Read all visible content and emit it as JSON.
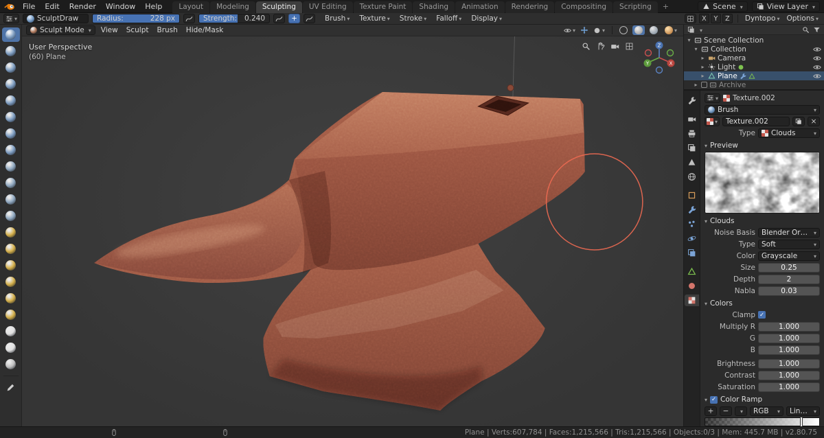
{
  "topbar": {
    "menus": [
      "File",
      "Edit",
      "Render",
      "Window",
      "Help"
    ],
    "tabs": [
      {
        "label": "Layout"
      },
      {
        "label": "Modeling"
      },
      {
        "label": "Sculpting",
        "active": true
      },
      {
        "label": "UV Editing"
      },
      {
        "label": "Texture Paint"
      },
      {
        "label": "Shading"
      },
      {
        "label": "Animation"
      },
      {
        "label": "Rendering"
      },
      {
        "label": "Compositing"
      },
      {
        "label": "Scripting"
      }
    ],
    "add_tab": "+",
    "scene_label": "Scene",
    "view_layer_label": "View Layer"
  },
  "tool_settings": {
    "brush_name": "SculptDraw",
    "radius": {
      "label": "Radius:",
      "value": "228 px",
      "fill": 1
    },
    "strength": {
      "label": "Strength:",
      "value": "0.240",
      "fill": 0.55
    },
    "plus": "+",
    "popovers": [
      {
        "label": "Brush"
      },
      {
        "label": "Texture"
      },
      {
        "label": "Stroke"
      },
      {
        "label": "Falloff"
      },
      {
        "label": "Display"
      }
    ],
    "mirror": [
      {
        "label": "X"
      },
      {
        "label": "Y"
      },
      {
        "label": "Z"
      }
    ],
    "dyntopo_label": "Dyntopo",
    "options_label": "Options"
  },
  "viewport_header": {
    "mode": "Sculpt Mode",
    "menus": [
      {
        "label": "View"
      },
      {
        "label": "Sculpt"
      },
      {
        "label": "Brush"
      },
      {
        "label": "Hide/Mask"
      }
    ]
  },
  "viewport": {
    "perspective_text": "User Perspective",
    "object_text": "(60) Plane",
    "clay_color": "#a05a45",
    "brush_cursor_color": "#ee6a52",
    "gizmo": {
      "x": "X",
      "y": "Y",
      "z": "Z"
    }
  },
  "sculpt_tools": [
    {
      "name": "draw",
      "color": "#7d9cc0",
      "active": true
    },
    {
      "name": "draw-sharp",
      "color": "#7d9cc0"
    },
    {
      "name": "clay",
      "color": "#7d9cc0"
    },
    {
      "name": "clay-strips",
      "color": "#7d9cc0"
    },
    {
      "name": "layer",
      "color": "#7d9cc0"
    },
    {
      "name": "inflate",
      "color": "#7d9cc0"
    },
    {
      "name": "blob",
      "color": "#7d9cc0"
    },
    {
      "name": "crease",
      "color": "#7d9cc0"
    },
    {
      "name": "smooth",
      "color": "#8fa7bf"
    },
    {
      "name": "flatten",
      "color": "#8fa7bf"
    },
    {
      "name": "fill",
      "color": "#8fa7bf"
    },
    {
      "name": "scrape",
      "color": "#8fa7bf"
    },
    {
      "name": "pinch",
      "color": "#d4af4a"
    },
    {
      "name": "grab",
      "color": "#d4af4a"
    },
    {
      "name": "elastic-deform",
      "color": "#d4af4a"
    },
    {
      "name": "snake-hook",
      "color": "#d4af4a"
    },
    {
      "name": "thumb",
      "color": "#d4af4a"
    },
    {
      "name": "pose",
      "color": "#d4af4a"
    },
    {
      "name": "nudge",
      "color": "#e0e0e0"
    },
    {
      "name": "rotate",
      "color": "#e0e0e0"
    },
    {
      "name": "mask",
      "color": "#bfbfbf"
    }
  ],
  "outliner": {
    "rows": [
      {
        "label": "Scene Collection",
        "icon": "collection",
        "level": 0,
        "disclosure": "▾",
        "color": "#d8d8d8"
      },
      {
        "label": "Collection",
        "icon": "collection",
        "level": 1,
        "disclosure": "▾",
        "eye": true,
        "color": "#d8d8d8"
      },
      {
        "label": "Camera",
        "icon": "camera",
        "level": 2,
        "disclosure": "▸",
        "eye": true,
        "color": "#c9a36a"
      },
      {
        "label": "Light",
        "icon": "light",
        "level": 2,
        "disclosure": "▸",
        "eye": true,
        "data_dot": true,
        "color": "#c9c9c9"
      },
      {
        "label": "Plane",
        "icon": "mesh",
        "level": 2,
        "disclosure": "▸",
        "eye": true,
        "selected": true,
        "extras": true,
        "color": "#7ec9b2"
      },
      {
        "label": "Archive",
        "icon": "collection",
        "level": 1,
        "disclosure": "▸",
        "checkbox": true,
        "dim": true,
        "color": "#9a9a9a"
      }
    ]
  },
  "prop_tabs": [
    {
      "name": "tool",
      "icon": "wrench",
      "color": "#c0c0c0"
    },
    {
      "name": "render",
      "icon": "camera",
      "color": "#c0c0c0",
      "gap": true
    },
    {
      "name": "output",
      "icon": "printer",
      "color": "#c0c0c0"
    },
    {
      "name": "view-layer",
      "icon": "layers",
      "color": "#c0c0c0"
    },
    {
      "name": "scene",
      "icon": "cone",
      "color": "#c0c0c0"
    },
    {
      "name": "world",
      "icon": "globe",
      "color": "#c0c0c0"
    },
    {
      "name": "object",
      "icon": "square",
      "color": "#d79c5a",
      "gap": true
    },
    {
      "name": "modifiers",
      "icon": "wrench",
      "color": "#7ba4d6"
    },
    {
      "name": "particles",
      "icon": "dots",
      "color": "#7ba4d6"
    },
    {
      "name": "physics",
      "icon": "orbit",
      "color": "#7ba4d6"
    },
    {
      "name": "constraints",
      "icon": "layers",
      "color": "#7ba4d6"
    },
    {
      "name": "object-data",
      "icon": "mesh",
      "color": "#7ec24f",
      "gap": true
    },
    {
      "name": "material",
      "icon": "circle",
      "color": "#d3756b"
    },
    {
      "name": "texture",
      "icon": "checker",
      "color": "#d3756b",
      "active": true
    }
  ],
  "properties": {
    "breadcrumb_name": "Texture.002",
    "brush_label": "Brush",
    "datablock_name": "Texture.002",
    "unlink": "×",
    "type_row": {
      "label": "Type",
      "value": "Clouds"
    },
    "sections": {
      "preview": "Preview",
      "clouds": "Clouds",
      "colors": "Colors"
    },
    "clouds_dropdowns": [
      {
        "label": "Noise Basis",
        "value": "Blender Original"
      },
      {
        "label": "Type",
        "value": "Soft"
      },
      {
        "label": "Color",
        "value": "Grayscale"
      }
    ],
    "clouds_numbers": [
      {
        "label": "Size",
        "value": "0.25"
      },
      {
        "label": "Depth",
        "value": "2"
      },
      {
        "label": "Nabla",
        "value": "0.03"
      }
    ],
    "clamp_label": "Clamp",
    "color_numbers": [
      {
        "label": "Multiply R",
        "value": "1.000"
      },
      {
        "label": "G",
        "value": "1.000"
      },
      {
        "label": "B",
        "value": "1.000"
      },
      {
        "label": "Brightness",
        "value": "1.000",
        "gap": true
      },
      {
        "label": "Contrast",
        "value": "1.000"
      },
      {
        "label": "Saturation",
        "value": "1.000"
      }
    ],
    "ramp": {
      "label": "Color Ramp",
      "add": "+",
      "remove": "−",
      "mode": "RGB",
      "interp": "Linear",
      "marker_pos": 0.84
    }
  },
  "status": {
    "stats": "Plane | Verts:607,784 | Faces:1,215,566 | Tris:1,215,566 | Objects:0/3 | Mem: 445.7 MB | v2.80.75"
  }
}
